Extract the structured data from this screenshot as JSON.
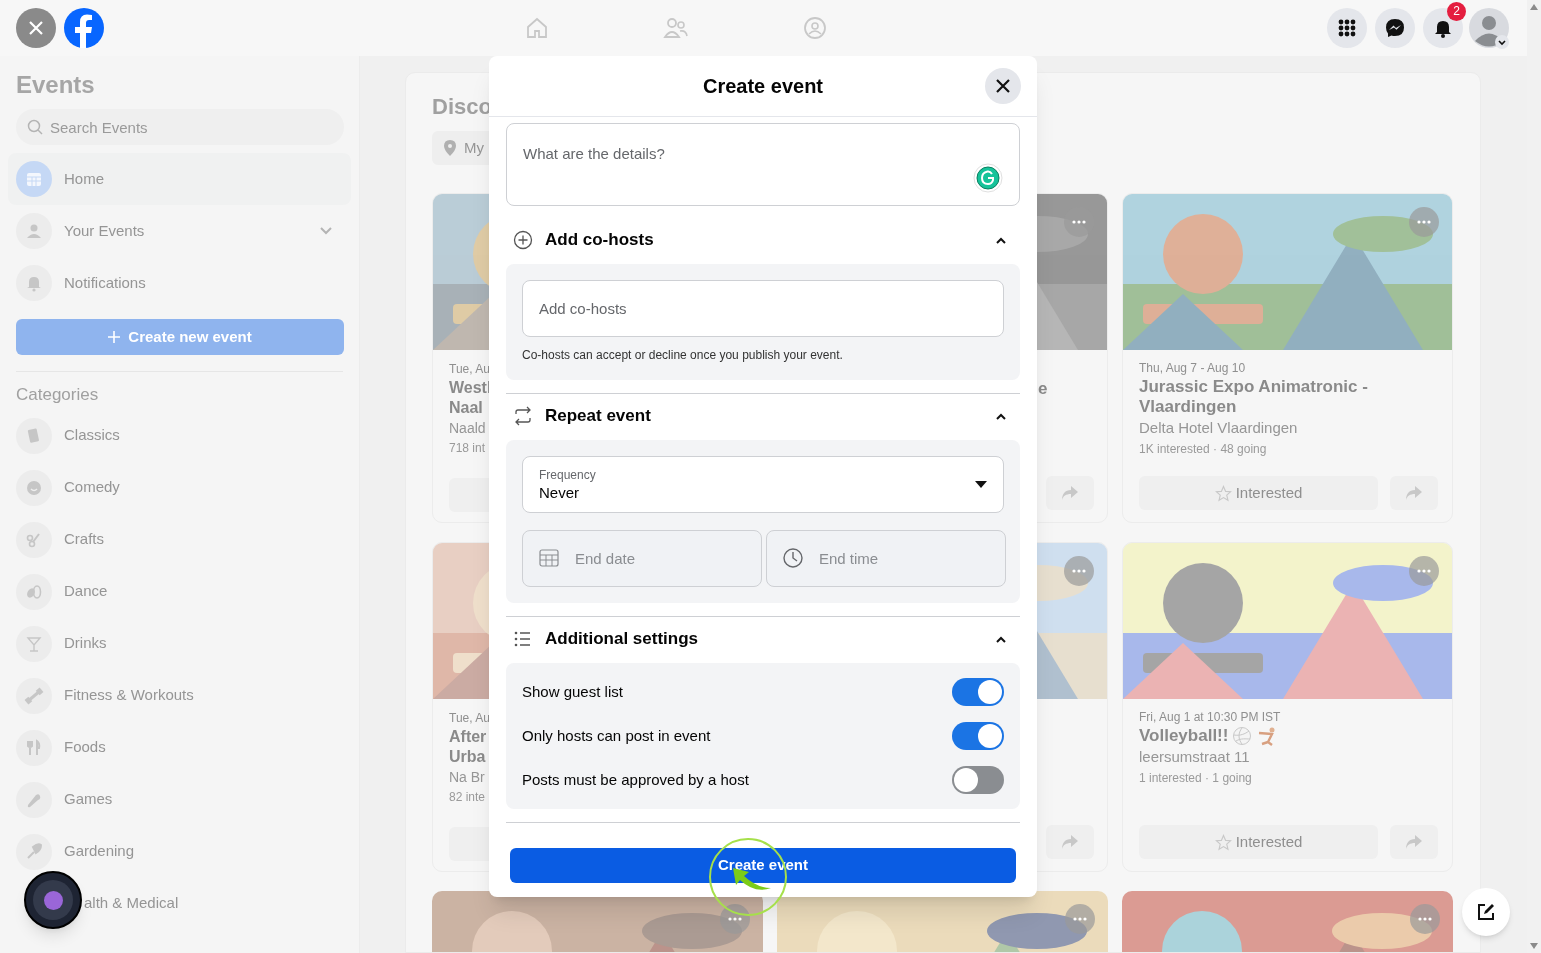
{
  "top_bar": {
    "notification_count": "2"
  },
  "sidebar": {
    "title": "Events",
    "search": {
      "placeholder": "Search Events"
    },
    "nav": [
      {
        "label": "Home",
        "selected": true,
        "expandable": false
      },
      {
        "label": "Your Events",
        "selected": false,
        "expandable": true
      },
      {
        "label": "Notifications",
        "selected": false,
        "expandable": false
      }
    ],
    "create_button": "Create new event",
    "categories_heading": "Categories",
    "categories": [
      "Classics",
      "Comedy",
      "Crafts",
      "Dance",
      "Drinks",
      "Fitness & Workouts",
      "Foods",
      "Games",
      "Gardening"
    ],
    "covered_category": "alth & Medical"
  },
  "discover": {
    "heading": "Disco",
    "location_chip": "My",
    "cards": [
      {
        "kind": "left",
        "date": "Tue, Au",
        "title_lines": [
          "Westl",
          "Naal"
        ],
        "location": "Naald",
        "stats": "718 int"
      },
      {
        "kind": "middle",
        "title_fragment": "e"
      },
      {
        "kind": "full",
        "date": "Thu, Aug 7 - Aug 10",
        "title": "Jurassic Expo Animatronic - Vlaardingen",
        "location": "Delta Hotel Vlaardingen",
        "stats": "1K interested · 48 going",
        "button": "Interested"
      },
      {
        "kind": "left",
        "date": "Tue, Au",
        "title_lines": [
          "After",
          "Urba"
        ],
        "location": "Na Br",
        "stats": "82 inte"
      },
      {
        "kind": "middle"
      },
      {
        "kind": "full",
        "date": "Fri, Aug 1 at 10:30 PM IST",
        "title": "Volleyball!!",
        "title_icons": true,
        "location": "leersumstraat 11",
        "stats": "1 interested · 1 going",
        "button": "Interested"
      },
      {
        "kind": "bottom"
      },
      {
        "kind": "bottom"
      },
      {
        "kind": "bottom"
      }
    ]
  },
  "modal": {
    "title": "Create event",
    "details": {
      "placeholder": "What are the details?"
    },
    "sections": [
      {
        "kind": "cohosts",
        "title": "Add co-hosts",
        "expanded": true,
        "field": {
          "placeholder": "Add co-hosts"
        },
        "hint": "Co-hosts can accept or decline once you publish your event."
      },
      {
        "kind": "repeat",
        "title": "Repeat event",
        "expanded": true,
        "frequency": {
          "label": "Frequency",
          "value": "Never"
        },
        "end_date": {
          "placeholder": "End date",
          "disabled": true
        },
        "end_time": {
          "placeholder": "End time",
          "disabled": true
        }
      },
      {
        "kind": "settings",
        "title": "Additional settings",
        "expanded": true,
        "toggles": [
          {
            "label": "Show guest list",
            "on": true
          },
          {
            "label": "Only hosts can post in event",
            "on": true
          },
          {
            "label": "Posts must be approved by a host",
            "on": false
          }
        ]
      }
    ],
    "submit": "Create event"
  }
}
